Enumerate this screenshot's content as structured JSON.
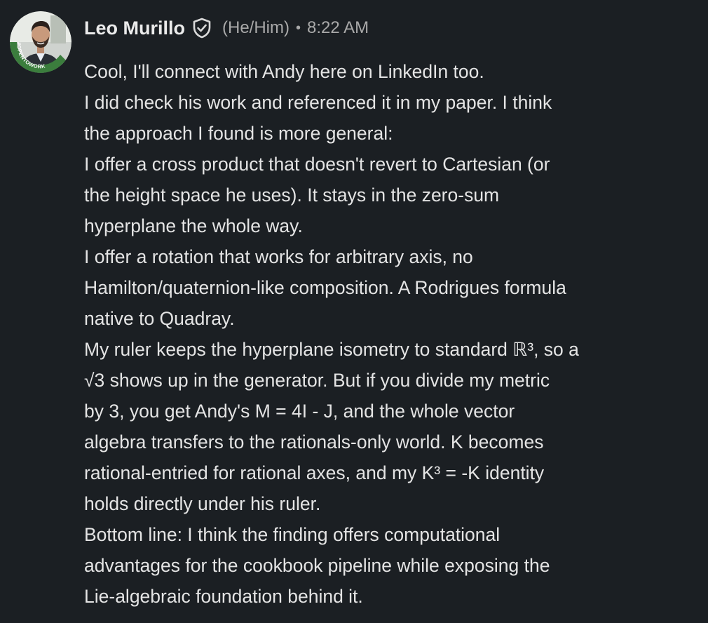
{
  "comment": {
    "author": {
      "name": "Leo Murillo",
      "pronouns": "(He/Him)",
      "badge_text": "#OPENTOWORK",
      "verified_icon": "verified-shield-icon"
    },
    "separator": "•",
    "timestamp": "8:22 AM",
    "lines": [
      "Cool, I'll connect with Andy here on LinkedIn too.",
      "I did check his work and referenced it in my paper. I think",
      "the approach I found is more general:",
      "I offer a cross product that doesn't revert to Cartesian (or",
      "the height space he uses). It stays in the zero-sum",
      "hyperplane the whole way.",
      "I offer a rotation that works for arbitrary axis, no",
      "Hamilton/quaternion-like composition. A Rodrigues formula",
      "native to Quadray.",
      "My ruler keeps the hyperplane isometry to standard ℝ³, so a",
      "√3 shows up in the generator. But if you divide my metric",
      "by 3, you get Andy's M = 4I - J, and the whole vector",
      "algebra transfers to the rationals-only world. K becomes",
      "rational-entried for rational axes, and my K³ = -K identity",
      "holds directly under his ruler.",
      "Bottom line: I think the finding offers computational",
      "advantages for the cookbook pipeline while exposing the",
      "Lie-algebraic foundation behind it."
    ]
  },
  "colors": {
    "background": "#1b1f23",
    "text": "#e4e4e4",
    "muted": "#a9a9a9",
    "open_to_work_green": "#3b7d3d"
  }
}
